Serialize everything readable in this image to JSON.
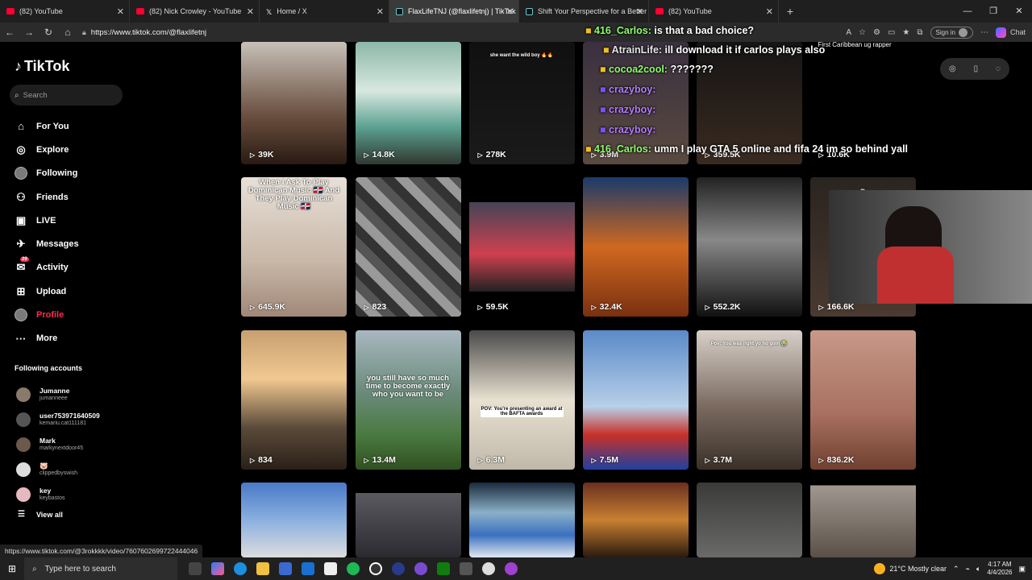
{
  "browser": {
    "tabs": [
      {
        "title": "(82) YouTube",
        "icon": "youtube-icon",
        "active": false
      },
      {
        "title": "(82) Nick Crowley - YouTube",
        "icon": "youtube-icon",
        "active": false
      },
      {
        "title": "Home / X",
        "icon": "x-icon",
        "active": false
      },
      {
        "title": "FlaxLifeTNJ (@flaxlifetnj) | TikTok",
        "icon": "tiktok-icon",
        "active": true
      },
      {
        "title": "Shift Your Perspective for a Better",
        "icon": "tiktok-icon",
        "active": false
      },
      {
        "title": "(82) YouTube",
        "icon": "youtube-icon",
        "active": false
      }
    ],
    "url": "https://www.tiktok.com/@flaxlifetnj",
    "signin_label": "Sign in",
    "chat_label": "Chat"
  },
  "sidebar": {
    "logo_text": "TikTok",
    "search_placeholder": "Search",
    "nav": [
      {
        "label": "For You",
        "icon": "home-icon"
      },
      {
        "label": "Explore",
        "icon": "compass-icon"
      },
      {
        "label": "Following",
        "icon": "avatar-icon"
      },
      {
        "label": "Friends",
        "icon": "friends-icon"
      },
      {
        "label": "LIVE",
        "icon": "live-icon"
      },
      {
        "label": "Messages",
        "icon": "messages-icon"
      },
      {
        "label": "Activity",
        "icon": "activity-icon",
        "badge": "29"
      },
      {
        "label": "Upload",
        "icon": "upload-icon"
      },
      {
        "label": "Profile",
        "icon": "profile-avatar-icon"
      },
      {
        "label": "More",
        "icon": "more-icon"
      }
    ],
    "following_title": "Following accounts",
    "accounts": [
      {
        "name": "Jumanne",
        "handle": "jumanneee",
        "color": "#8a7a6a"
      },
      {
        "name": "user753971640509",
        "handle": "kemariu.cat111181",
        "color": "#555555"
      },
      {
        "name": "Mark",
        "handle": "markynextdoor45",
        "color": "#6b5a4a"
      },
      {
        "name": "🐷",
        "handle": "clippedbyswish",
        "color": "#dddddd"
      },
      {
        "name": "key",
        "handle": "keybastos",
        "color": "#e6b8c0"
      }
    ],
    "view_all": "View all"
  },
  "videos": [
    {
      "views": "39K",
      "bg": "linear-gradient(180deg,#c8c0b8,#6a5040 60%,#2a1a12)",
      "caption": ""
    },
    {
      "views": "14.8K",
      "bg": "linear-gradient(180deg,#8cb8a8,#d8e8e0 40%,#5aa090 70%,#303830)",
      "caption": ""
    },
    {
      "views": "278K",
      "bg": "linear-gradient(180deg,#101010,#1a1a1a)",
      "caption": "she want the wild boy 🔥🔥"
    },
    {
      "views": "3.9M",
      "bg": "linear-gradient(180deg,#3a3040,#5a4a40)",
      "caption": ""
    },
    {
      "views": "359.5K",
      "bg": "linear-gradient(180deg,#151515,#3a2a20)",
      "caption": ""
    },
    {
      "views": "10.6K",
      "bg": "linear-gradient(180deg,#000,#000)",
      "caption": "First Caribbean ug rapper"
    },
    {
      "views": "645.9K",
      "bg": "linear-gradient(180deg,#e8e0d8,#c8b8a8 60%,#a08878)",
      "caption": "When I Ask To Play Dominican Music 🇩🇴 And They Play Dominican Music 🇩🇴"
    },
    {
      "views": "823",
      "bg": "repeating-linear-gradient(45deg,#333 0 12px,#999 12px 24px,#555 24px 36px)",
      "caption": ""
    },
    {
      "views": "59.5K",
      "bg": "linear-gradient(180deg,#000 0,#000 18%,#445 18%,#d04050 55%,#222 82%,#000 82%)",
      "caption": ""
    },
    {
      "views": "32.4K",
      "bg": "linear-gradient(180deg,#1a3a6a,#d06820 50%,#7a3010)",
      "caption": ""
    },
    {
      "views": "552.2K",
      "bg": "linear-gradient(180deg,#222,#888 45%,#111)",
      "caption": ""
    },
    {
      "views": "166.6K",
      "bg": "linear-gradient(180deg,#2a2420,#4a3a30)",
      "caption": "m"
    },
    {
      "views": "834",
      "bg": "linear-gradient(180deg,#c8a070,#f0c890 35%,#5a4a3a 70%,#2a2018)",
      "caption": ""
    },
    {
      "views": "13.4M",
      "bg": "linear-gradient(180deg,#a8b8c0,#6a8a7a 45%,#4a7a40 75%,#305020)",
      "caption": "you still have so much time to become exactly who you want to be"
    },
    {
      "views": "6.3M",
      "bg": "linear-gradient(180deg,#4a4a4a,#e8e0d0 50%,#c0b8a8)",
      "caption": "POV: You're presenting an award at the BAFTA awards"
    },
    {
      "views": "7.5M",
      "bg": "linear-gradient(180deg,#5a8ac8,#b8d0e8 55%,#c83028 75%,#2040a0)",
      "caption": ""
    },
    {
      "views": "3.7M",
      "bg": "linear-gradient(180deg,#d8d0c8,#7a6a60 55%,#3a3028)",
      "caption": "Pov: You was right yo ho goin 😭"
    },
    {
      "views": "836.2K",
      "bg": "linear-gradient(180deg,#c89888,#a87060 60%,#704030)",
      "caption": ""
    },
    {
      "views": "",
      "bg": "linear-gradient(180deg,#4a7ac8,#8ab0e0 50%,#ddd)",
      "caption": ""
    },
    {
      "views": "",
      "bg": "linear-gradient(180deg,#000 0,#000 14%,#5a5a60 14%,#2a2a30)",
      "caption": ""
    },
    {
      "views": "",
      "bg": "linear-gradient(180deg,#1a2a3a,#8ab0c8 40%,#3a70c0 70%,#e0e8f0)",
      "caption": ""
    },
    {
      "views": "",
      "bg": "linear-gradient(180deg,#6a3020,#c88030 50%,#2a1a10)",
      "caption": ""
    },
    {
      "views": "",
      "bg": "linear-gradient(180deg,#3a3a38,#6a6a68)",
      "caption": ""
    },
    {
      "views": "",
      "bg": "linear-gradient(180deg,#000 0,#000 4%,#a09890 4%,#5a5048)",
      "caption": ""
    }
  ],
  "stream_chat": [
    {
      "user": "416_Carlos:",
      "text": "is that a bad choice?",
      "style": "green"
    },
    {
      "user": "AtrainLife:",
      "text": "ill download it if carlos plays also",
      "style": ""
    },
    {
      "user": "cocoa2cool:",
      "text": "???????",
      "style": "green"
    },
    {
      "user": "crazyboy:",
      "text": "",
      "style": "purple"
    },
    {
      "user": "crazyboy:",
      "text": "",
      "style": "purple"
    },
    {
      "user": "crazyboy:",
      "text": "",
      "style": "purple"
    },
    {
      "user": "416_Carlos:",
      "text": "umm I play GTA 5 online and fifa 24 im so behind yall",
      "style": "green"
    }
  ],
  "status_url": "https://www.tiktok.com/@3rokkkk/video/7607602699722444046",
  "taskbar": {
    "search_placeholder": "Type here to search",
    "weather": "21°C  Mostly clear",
    "time": "4:17 AM",
    "date": "4/4/2026"
  }
}
